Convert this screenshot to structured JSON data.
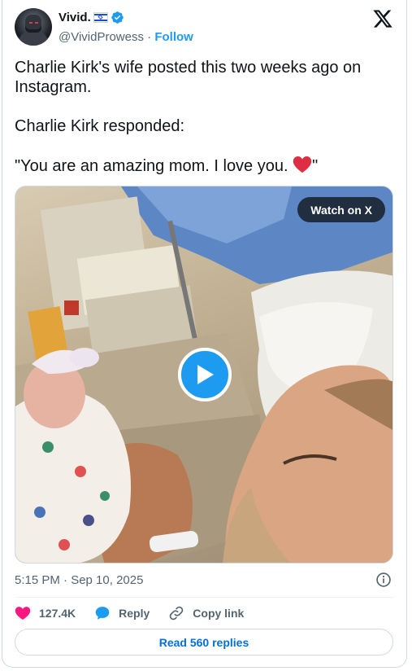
{
  "author": {
    "display_name": "Vivid.",
    "handle": "@VividProwess",
    "separator": "·",
    "follow_label": "Follow"
  },
  "tweet": {
    "lines": [
      "Charlie Kirk's wife posted this two weeks ago on Instagram.",
      "Charlie Kirk responded:",
      "\"You are an amazing mom. I love you. ",
      "\""
    ]
  },
  "media": {
    "watch_label": "Watch on X"
  },
  "meta": {
    "timestamp": "5:15 PM · Sep 10, 2025"
  },
  "actions": {
    "likes_count": "127.4K",
    "reply_label": "Reply",
    "copy_link_label": "Copy link"
  },
  "read_replies_label": "Read 560 replies",
  "colors": {
    "accent": "#1d9bf0",
    "link_blue": "#006fd6",
    "like_pink": "#f91880",
    "muted": "#536471",
    "border": "#cfd9de"
  },
  "icons": [
    "x-logo-icon",
    "verified-badge-icon",
    "israel-flag-icon",
    "play-icon",
    "info-icon",
    "heart-icon",
    "reply-bubble-icon",
    "link-icon",
    "red-heart-emoji-icon"
  ]
}
